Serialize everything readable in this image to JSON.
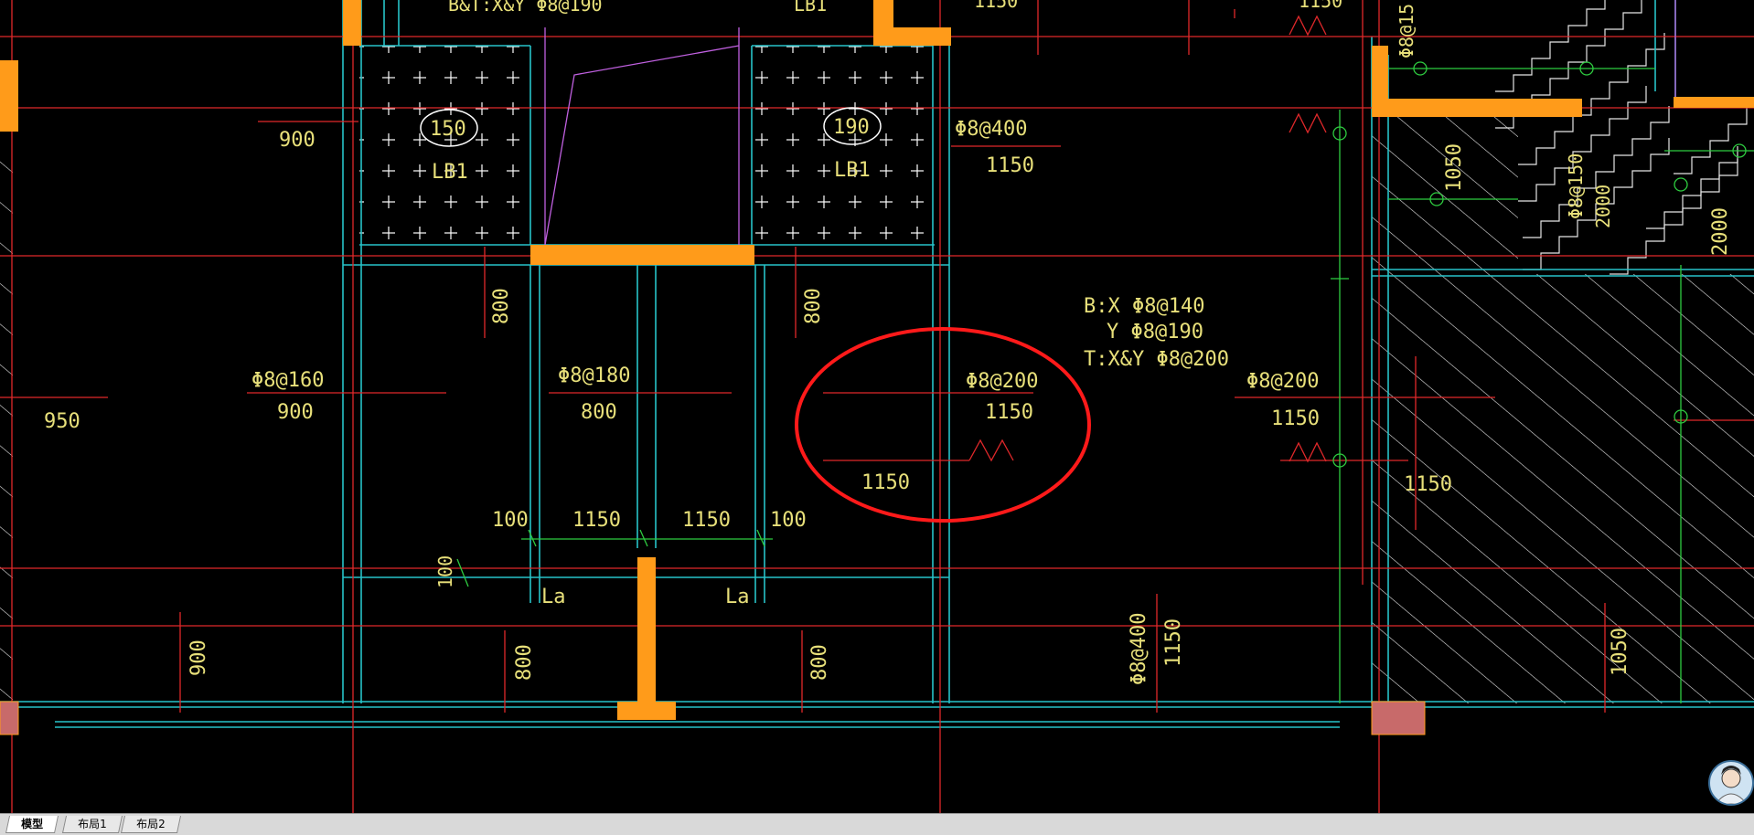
{
  "drawing": {
    "top_partial_labels": [
      "B&T:X&Y Φ8@190",
      "LB1",
      "1150",
      "1150",
      "Φ8@15"
    ],
    "slab_marks": [
      {
        "thickness": "150",
        "name": "LB1"
      },
      {
        "thickness": "190",
        "name": "LB1"
      }
    ],
    "rebar_labels": [
      {
        "text": "Φ8@400",
        "span": "1150"
      },
      {
        "text": "Φ8@160",
        "span": "900"
      },
      {
        "text": "Φ8@180",
        "span": "800"
      },
      {
        "text": "Φ8@200",
        "span": "1150"
      },
      {
        "text": "Φ8@200",
        "span": "1150"
      },
      {
        "text": "Φ8@400",
        "span": "1150"
      },
      {
        "text": "Φ8@150",
        "span": "2000"
      }
    ],
    "slab_reinforcement_note": [
      "B:X Φ8@140",
      "Y Φ8@190",
      "T:X&Y Φ8@200"
    ],
    "dimensions": [
      "900",
      "950",
      "800",
      "800",
      "100",
      "1150",
      "1150",
      "100",
      "100",
      "900",
      "800",
      "800",
      "1150",
      "1150",
      "1050",
      "2000",
      "1050",
      "1150"
    ],
    "anchorage_labels": [
      "La",
      "La"
    ],
    "highlighted_region": {
      "label": "1150",
      "rebar": "Φ8@200",
      "span": "1150"
    },
    "colors": {
      "background": "#000000",
      "axis_line": "#e0282a",
      "wall_outline": "#27c3c9",
      "column_fill": "#ff9b1a",
      "text": "#e8e07a",
      "dimension_line": "#2ecc40",
      "hatch": "#e6e6e6",
      "highlight_circle": "#ff1a1a",
      "magenta_line": "#c060e0"
    }
  },
  "layout_tabs": [
    {
      "label": "模型",
      "active": true
    },
    {
      "label": "布局1",
      "active": false
    },
    {
      "label": "布局2",
      "active": false
    }
  ],
  "user": {
    "avatar_icon": "user-avatar-icon"
  }
}
